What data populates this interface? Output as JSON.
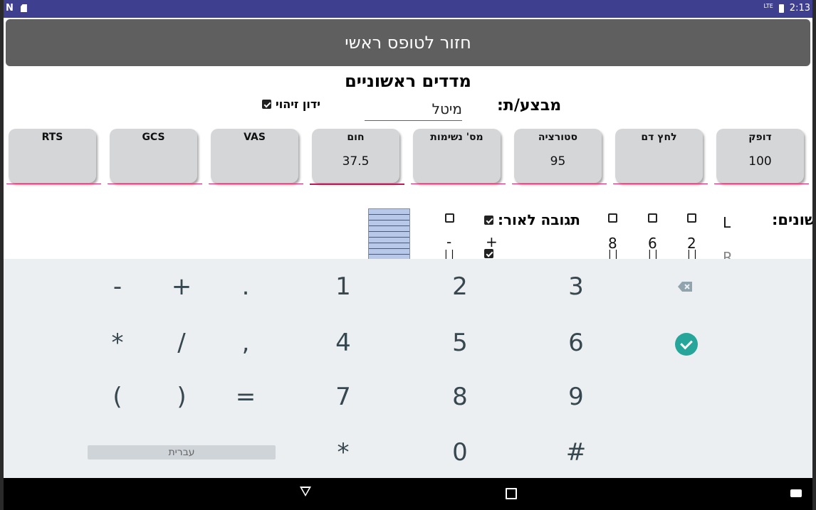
{
  "status_bar": {
    "time": "2:13",
    "network": "LTE"
  },
  "header": {
    "back_button_label": "חזור לטופס ראשי"
  },
  "page_title": "מדדים ראשוניים",
  "performer": {
    "label": "מבצע/ת:",
    "value": "מיטל"
  },
  "id_check": {
    "label": "ידון זיהוי",
    "checked": true
  },
  "vitals": [
    {
      "label": "דופק",
      "value": "100"
    },
    {
      "label": "לחץ דם",
      "value": ""
    },
    {
      "label": "סטורציה",
      "value": "95"
    },
    {
      "label": "מס' נשימות",
      "value": ""
    },
    {
      "label": "חום",
      "value": "37.5"
    },
    {
      "label": "VAS",
      "value": ""
    },
    {
      "label": "GCS",
      "value": ""
    },
    {
      "label": "RTS",
      "value": ""
    }
  ],
  "pupils": {
    "label": "אישונים:",
    "side_l": "L",
    "side_r": "R",
    "sizes": [
      "2",
      "6",
      "8"
    ],
    "light_label": "תגובה לאור:",
    "plus": "+",
    "minus": "-"
  },
  "keyboard": {
    "row1": [
      "-",
      "+",
      ".",
      "1",
      "2",
      "3"
    ],
    "row2": [
      "*",
      "/",
      ",",
      "4",
      "5",
      "6"
    ],
    "row3": [
      "(",
      ")",
      "=",
      "7",
      "8",
      "9"
    ],
    "row4": [
      "*",
      "0",
      "#"
    ],
    "lang": "עברית"
  },
  "colors": {
    "accent": "#e91e63",
    "statusbar": "#3f3f8f",
    "header": "#5f5f5f",
    "enter": "#26a69a"
  }
}
